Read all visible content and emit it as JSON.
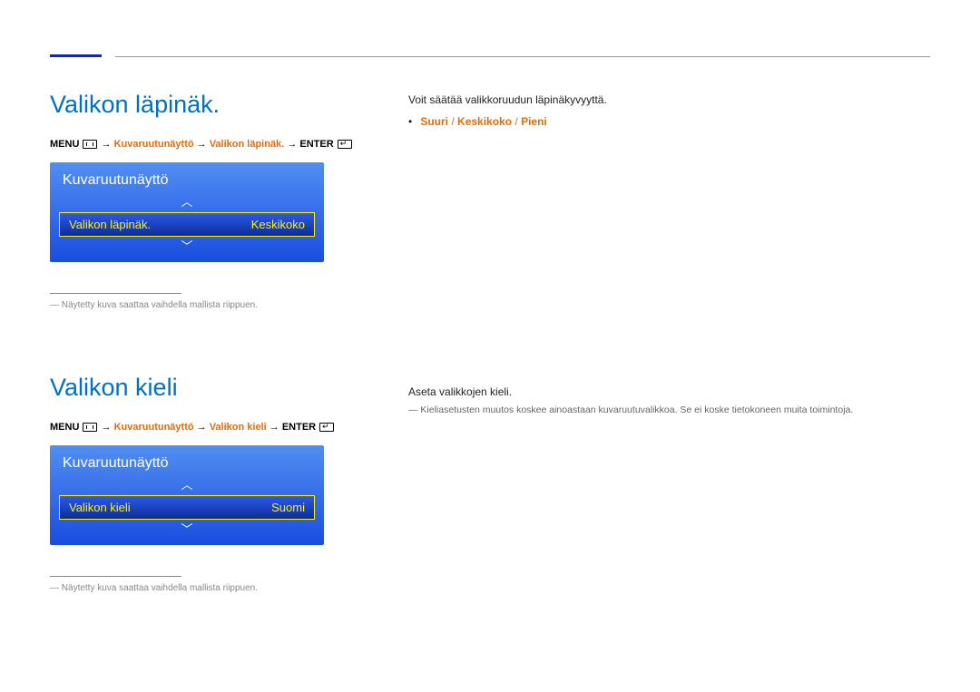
{
  "section1": {
    "heading": "Valikon läpinäk.",
    "path": {
      "prefix": "MENU",
      "mid1": "Kuvaruutunäyttö",
      "mid2": "Valikon läpinäk.",
      "suffix": "ENTER"
    },
    "osd": {
      "title": "Kuvaruutunäyttö",
      "rowLabel": "Valikon läpinäk.",
      "rowValue": "Keskikoko"
    },
    "footnote": "Näytetty kuva saattaa vaihdella mallista riippuen.",
    "right": {
      "line1": "Voit säätää valikkoruudun läpinäkyvyyttä.",
      "opt1": "Suuri",
      "opt2": "Keskikoko",
      "opt3": "Pieni"
    }
  },
  "section2": {
    "heading": "Valikon kieli",
    "path": {
      "prefix": "MENU",
      "mid1": "Kuvaruutunäyttö",
      "mid2": "Valikon kieli",
      "suffix": "ENTER"
    },
    "osd": {
      "title": "Kuvaruutunäyttö",
      "rowLabel": "Valikon kieli",
      "rowValue": "Suomi"
    },
    "footnote": "Näytetty kuva saattaa vaihdella mallista riippuen.",
    "right": {
      "line1": "Aseta valikkojen kieli.",
      "note": "Kieliasetusten muutos koskee ainoastaan kuvaruutuvalikkoa. Se ei koske tietokoneen muita toimintoja."
    }
  },
  "arrows": {
    "up": "︿",
    "down": "﹀"
  },
  "sep": " → "
}
